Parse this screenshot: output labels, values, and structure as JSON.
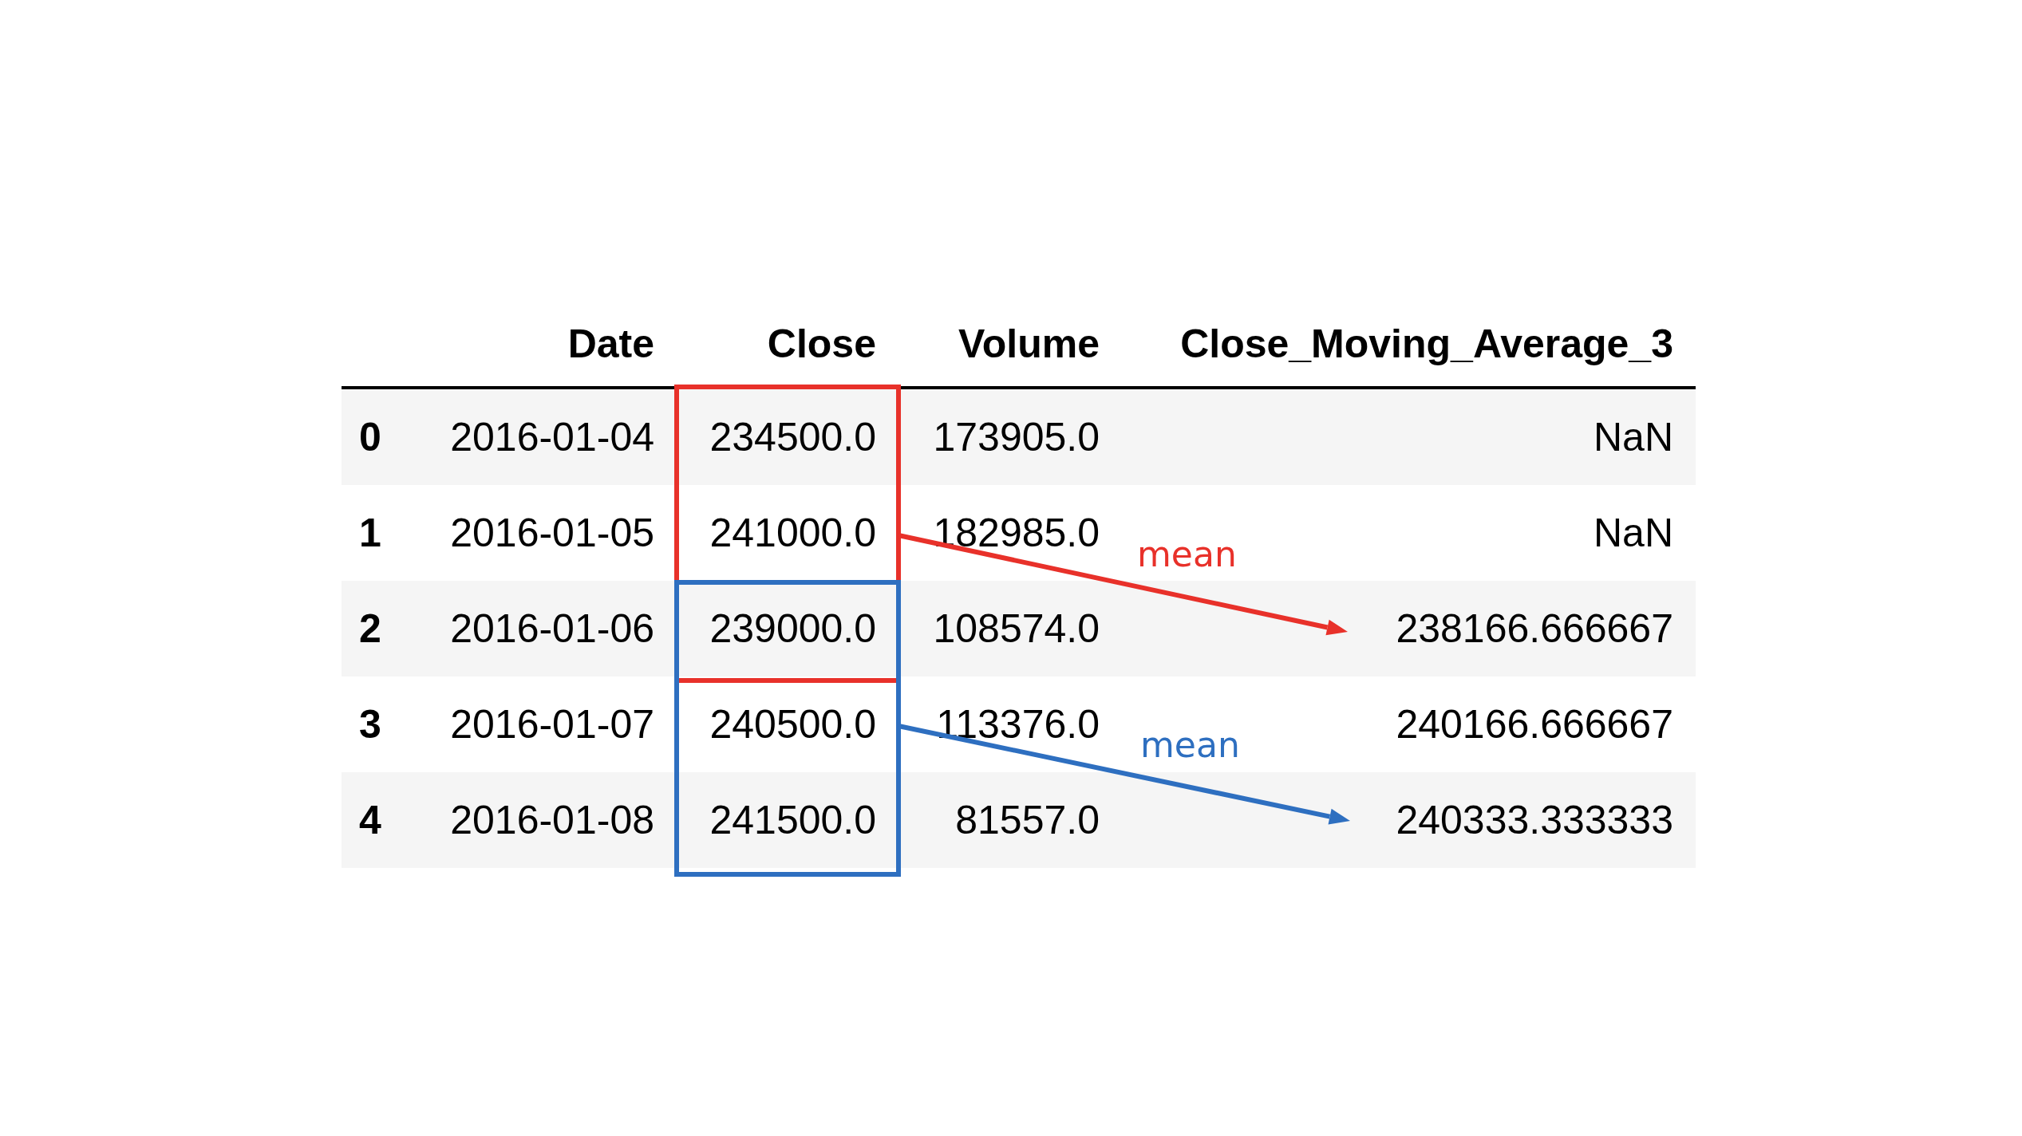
{
  "table": {
    "columns": [
      "Date",
      "Close",
      "Volume",
      "Close_Moving_Average_3"
    ],
    "rows": [
      {
        "index": "0",
        "cells": [
          "2016-01-04",
          "234500.0",
          "173905.0",
          "NaN"
        ]
      },
      {
        "index": "1",
        "cells": [
          "2016-01-05",
          "241000.0",
          "182985.0",
          "NaN"
        ]
      },
      {
        "index": "2",
        "cells": [
          "2016-01-06",
          "239000.0",
          "108574.0",
          "238166.666667"
        ]
      },
      {
        "index": "3",
        "cells": [
          "2016-01-07",
          "240500.0",
          "113376.0",
          "240166.666667"
        ]
      },
      {
        "index": "4",
        "cells": [
          "2016-01-08",
          "241500.0",
          "81557.0",
          "240333.333333"
        ]
      }
    ]
  },
  "annotations": [
    {
      "label": "mean",
      "color": "#e8312a"
    },
    {
      "label": "mean",
      "color": "#2e6fc0"
    }
  ]
}
